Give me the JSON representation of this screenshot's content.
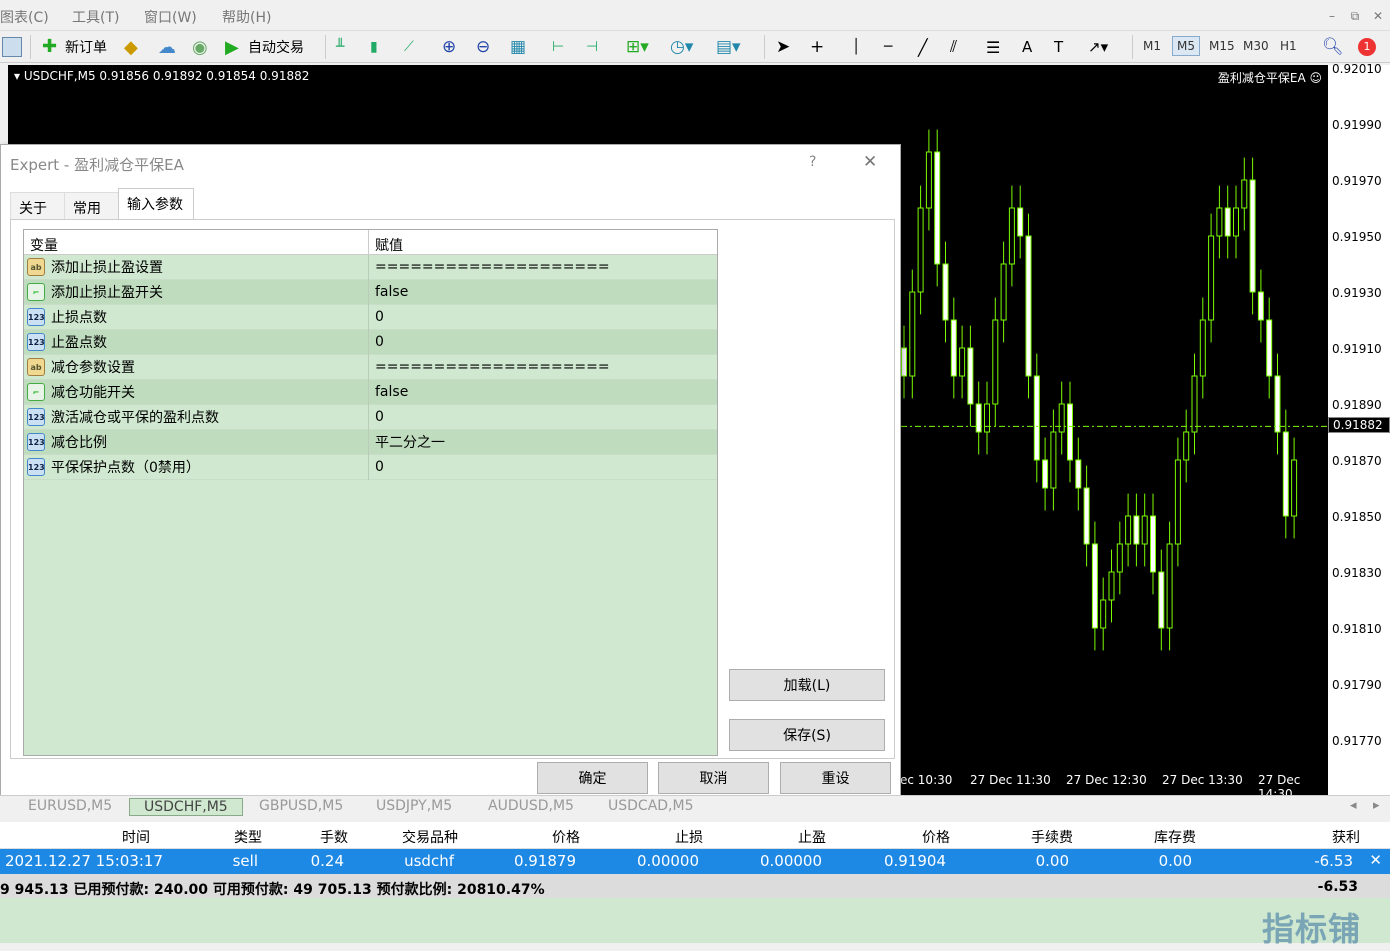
{
  "menu": {
    "chart": "图表(C)",
    "tools": "工具(T)",
    "window": "窗口(W)",
    "help": "帮助(H)"
  },
  "toolbar": {
    "new_order": "新订单",
    "auto_trade": "自动交易",
    "timeframes": [
      "M1",
      "M5",
      "M15",
      "M30",
      "H1"
    ],
    "active_timeframe": "M5",
    "notification_count": "1"
  },
  "chart": {
    "symbol_line": "USDCHF,M5  0.91856 0.91892 0.91854 0.91882",
    "ea_label": "盈利减仓平保EA ☺",
    "current_price": "0.91882",
    "price_ticks": [
      "0.92010",
      "0.91990",
      "0.91970",
      "0.91950",
      "0.91930",
      "0.91910",
      "0.91890",
      "0.91870",
      "0.91850",
      "0.91830",
      "0.91810",
      "0.91790",
      "0.91770"
    ],
    "time_ticks": [
      "ec 10:30",
      "27 Dec 11:30",
      "27 Dec 12:30",
      "27 Dec 13:30",
      "27 Dec 14:30"
    ],
    "colors": {
      "bg": "#000000",
      "candle": "#7CFC00",
      "grid_line": "#7CFC00"
    }
  },
  "dialog": {
    "title": "Expert - 盈利减仓平保EA",
    "help": "?",
    "close": "✕",
    "tabs": [
      {
        "label": "关于"
      },
      {
        "label": "常用"
      },
      {
        "label": "输入参数"
      }
    ],
    "headers": {
      "var": "变量",
      "val": "赋值"
    },
    "rows": [
      {
        "icon": "ab",
        "name": "添加止损止盈设置",
        "value": "===================="
      },
      {
        "icon": "sw",
        "name": "添加止损止盈开关",
        "value": "false"
      },
      {
        "icon": "123",
        "name": "止损点数",
        "value": "0"
      },
      {
        "icon": "123",
        "name": "止盈点数",
        "value": "0"
      },
      {
        "icon": "ab",
        "name": "减仓参数设置",
        "value": "===================="
      },
      {
        "icon": "sw",
        "name": "减仓功能开关",
        "value": "false"
      },
      {
        "icon": "123",
        "name": "激活减仓或平保的盈利点数",
        "value": "0"
      },
      {
        "icon": "123",
        "name": "减仓比例",
        "value": "平二分之一"
      },
      {
        "icon": "123",
        "name": "平保保护点数（0禁用）",
        "value": "0"
      }
    ],
    "load": "加载(L)",
    "save": "保存(S)",
    "ok": "确定",
    "cancel": "取消",
    "reset": "重设"
  },
  "chart_tabs": [
    "EURUSD,M5",
    "USDCHF,M5",
    "GBPUSD,M5",
    "USDJPY,M5",
    "AUDUSD,M5",
    "USDCAD,M5"
  ],
  "active_chart_tab": "USDCHF,M5",
  "terminal": {
    "headers": [
      "时间",
      "类型",
      "手数",
      "交易品种",
      "价格",
      "止损",
      "止盈",
      "价格",
      "手续费",
      "库存费",
      "获利"
    ],
    "row": [
      "2021.12.27 15:03:17",
      "sell",
      "0.24",
      "usdchf",
      "0.91879",
      "0.00000",
      "0.00000",
      "0.91904",
      "0.00",
      "0.00",
      "-6.53"
    ],
    "summary": "9 945.13  已用预付款: 240.00  可用预付款: 49 705.13  预付款比例: 20810.47%",
    "summary_profit": "-6.53"
  },
  "watermark": "指标铺"
}
